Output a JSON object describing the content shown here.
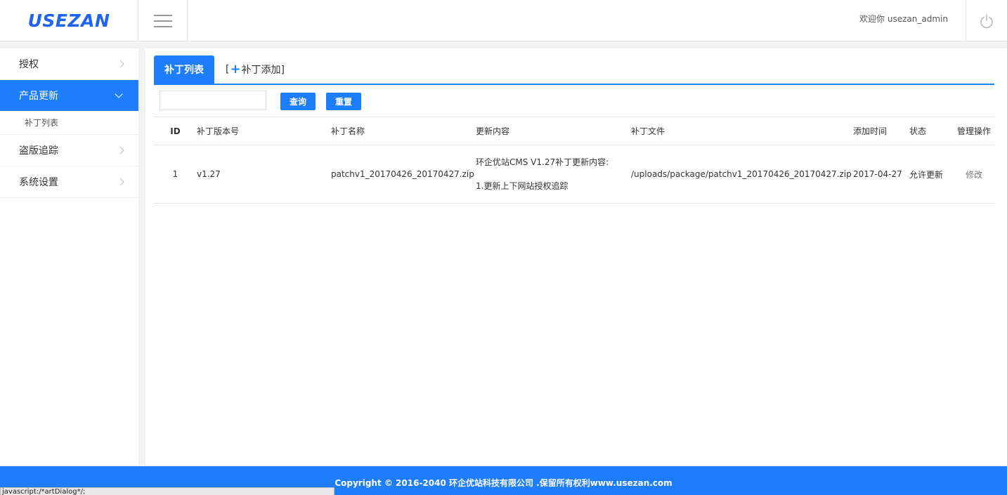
{
  "header": {
    "logo": "USEZAN",
    "welcome_prefix": "欢迎你",
    "username": "usezan_admin"
  },
  "sidebar": {
    "items": [
      {
        "label": "授权"
      },
      {
        "label": "产品更新",
        "active": true,
        "sub": [
          {
            "label": "补丁列表"
          }
        ]
      },
      {
        "label": "盗版追踪"
      },
      {
        "label": "系统设置"
      }
    ]
  },
  "tabs": {
    "active": "补丁列表",
    "add_prefix": "[",
    "add_plus": "+",
    "add_label": "补丁添加]"
  },
  "search": {
    "value": "",
    "search_button": "查询",
    "reset_button": "重置"
  },
  "table": {
    "columns": [
      "ID",
      "补丁版本号",
      "补丁名称",
      "更新内容",
      "补丁文件",
      "添加时间",
      "状态",
      "管理操作"
    ],
    "rows": [
      {
        "id": "1",
        "version": "v1.27",
        "name": "patchv1_20170426_20170427.zip",
        "content_line1": "环企优站CMS V1.27补丁更新内容:",
        "content_line2": "1.更新上下网站授权追踪",
        "file": "/uploads/package/patchv1_20170426_20170427.zip",
        "date": "2017-04-27",
        "status": "允许更新",
        "action": "修改"
      }
    ]
  },
  "footer": {
    "copyright": "Copyright © 2016-2040 环企优站科技有限公司 .保留所有权利www.usezan.com"
  },
  "statusbar": {
    "text": "javascript:/*artDialog*/;"
  },
  "colors": {
    "accent": "#1e7dfa",
    "logo": "#1e64f0"
  }
}
